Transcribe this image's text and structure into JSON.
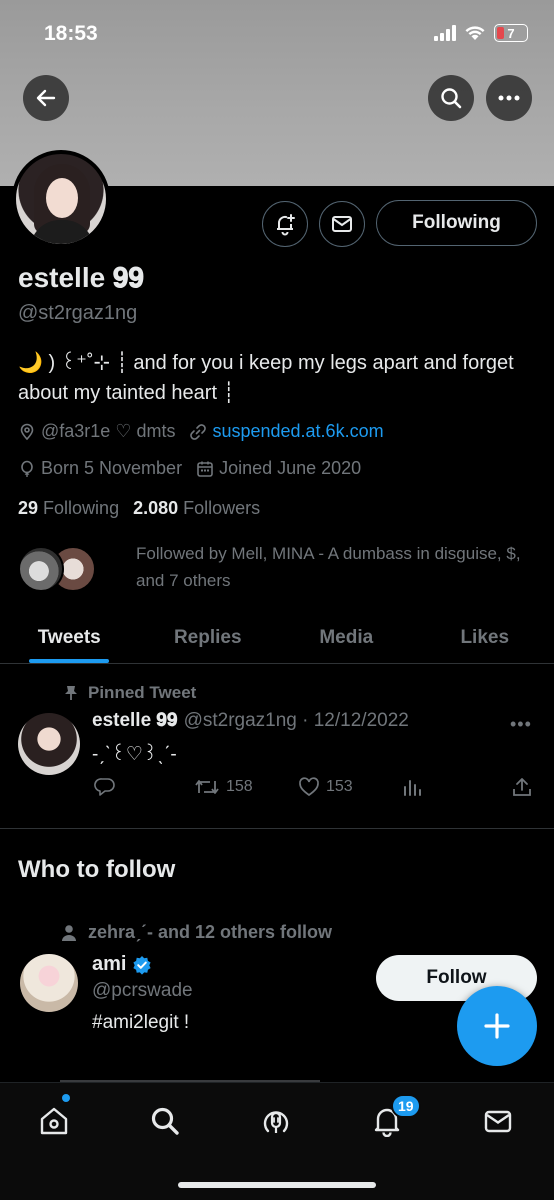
{
  "status_bar": {
    "time": "18:53",
    "battery": "7"
  },
  "profile": {
    "display_name": "estelle 𝟗𝟗",
    "handle": "@st2rgaz1ng",
    "bio": "🌙 ) ꒰⁺˚⊹ ┊ and for you i keep my legs apart and forget about my tainted heart ┊",
    "location": "@fa3r1e ♡ dmts",
    "website": "suspended.at.6k.com",
    "birthday": "Born 5 November",
    "joined": "Joined June 2020",
    "following_count": "29",
    "following_label": "Following",
    "followers_count": "2.080",
    "followers_label": "Followers",
    "followed_by": "Followed by Mell, MINA - A dumbass in disguise, $, and 7 others",
    "following_button": "Following"
  },
  "tabs": [
    {
      "label": "Tweets"
    },
    {
      "label": "Replies"
    },
    {
      "label": "Media"
    },
    {
      "label": "Likes"
    }
  ],
  "pinned_tweet": {
    "pinned_label": "Pinned Tweet",
    "name": "estelle 𝟗𝟗",
    "handle_date": "@st2rgaz1ng · 12/12/2022",
    "text": "-ˏˋ꒰♡꒱ˎˊ-",
    "retweets": "158",
    "likes": "153"
  },
  "who_to_follow": {
    "title": "Who to follow",
    "context": "zehraˏˊ- and 12 others follow",
    "name": "ami",
    "handle": "@pcrswade",
    "bio": "#ami2legit !",
    "follow_button": "Follow"
  },
  "bottom_nav": {
    "notifications_badge": "19"
  },
  "colors": {
    "accent": "#1d9bf0",
    "background": "#000000",
    "muted": "#71767b",
    "text": "#e7e9ea"
  }
}
